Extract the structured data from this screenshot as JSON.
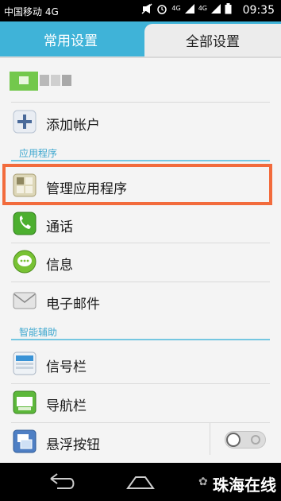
{
  "status_bar": {
    "carrier": "中国移动 4G",
    "network_left": "4G",
    "network_right": "4G",
    "time": "09:35"
  },
  "tabs": {
    "common": "常用设置",
    "all": "全部设置"
  },
  "account": {
    "add_account": "添加帐户"
  },
  "sections": {
    "apps": "应用程序",
    "smart_assist": "智能辅助"
  },
  "items": {
    "manage_apps": "管理应用程序",
    "calls": "通话",
    "messages": "信息",
    "email": "电子邮件",
    "notification_bar": "信号栏",
    "nav_bar": "导航栏",
    "floating_button": "悬浮按钮"
  },
  "floating_button_toggle": {
    "on": false
  },
  "watermark": "珠海在线",
  "colors": {
    "accent": "#3fb3d8",
    "highlight": "#f26b3c",
    "status_bar": "#000000",
    "nav_bar": "#000000"
  },
  "icons": {
    "add_account": "plus-icon",
    "manage_apps": "app-grid-icon",
    "calls": "phone-icon",
    "messages": "chat-bubble-icon",
    "email": "envelope-icon",
    "notification_bar": "status-bar-icon",
    "nav_bar": "nav-bar-icon",
    "floating_button": "floating-button-icon",
    "back": "back-icon",
    "home": "home-icon"
  }
}
